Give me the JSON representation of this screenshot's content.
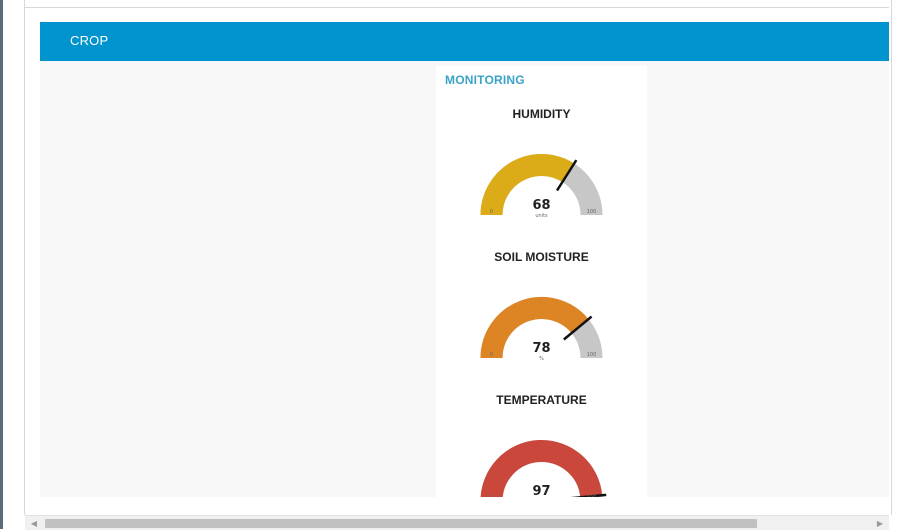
{
  "header": {
    "title": "CROP"
  },
  "group": {
    "title": "MONITORING"
  },
  "gauges": [
    {
      "title": "HUMIDITY",
      "value": 68,
      "unit": "units",
      "min": 0,
      "max": 100,
      "color": "#dcab18"
    },
    {
      "title": "SOIL MOISTURE",
      "value": 78,
      "unit": "%",
      "min": 0,
      "max": 100,
      "color": "#dd8525"
    },
    {
      "title": "TEMPERATURE",
      "value": 97,
      "unit": "",
      "min": 0,
      "max": 100,
      "color": "#c9483b"
    }
  ],
  "colors": {
    "track": "#c7c7c7",
    "needle": "#111111",
    "header": "#0094ce",
    "accent": "#3aa3c7"
  },
  "scrollbar": {
    "left_arrow": "◀",
    "right_arrow": "▶"
  }
}
